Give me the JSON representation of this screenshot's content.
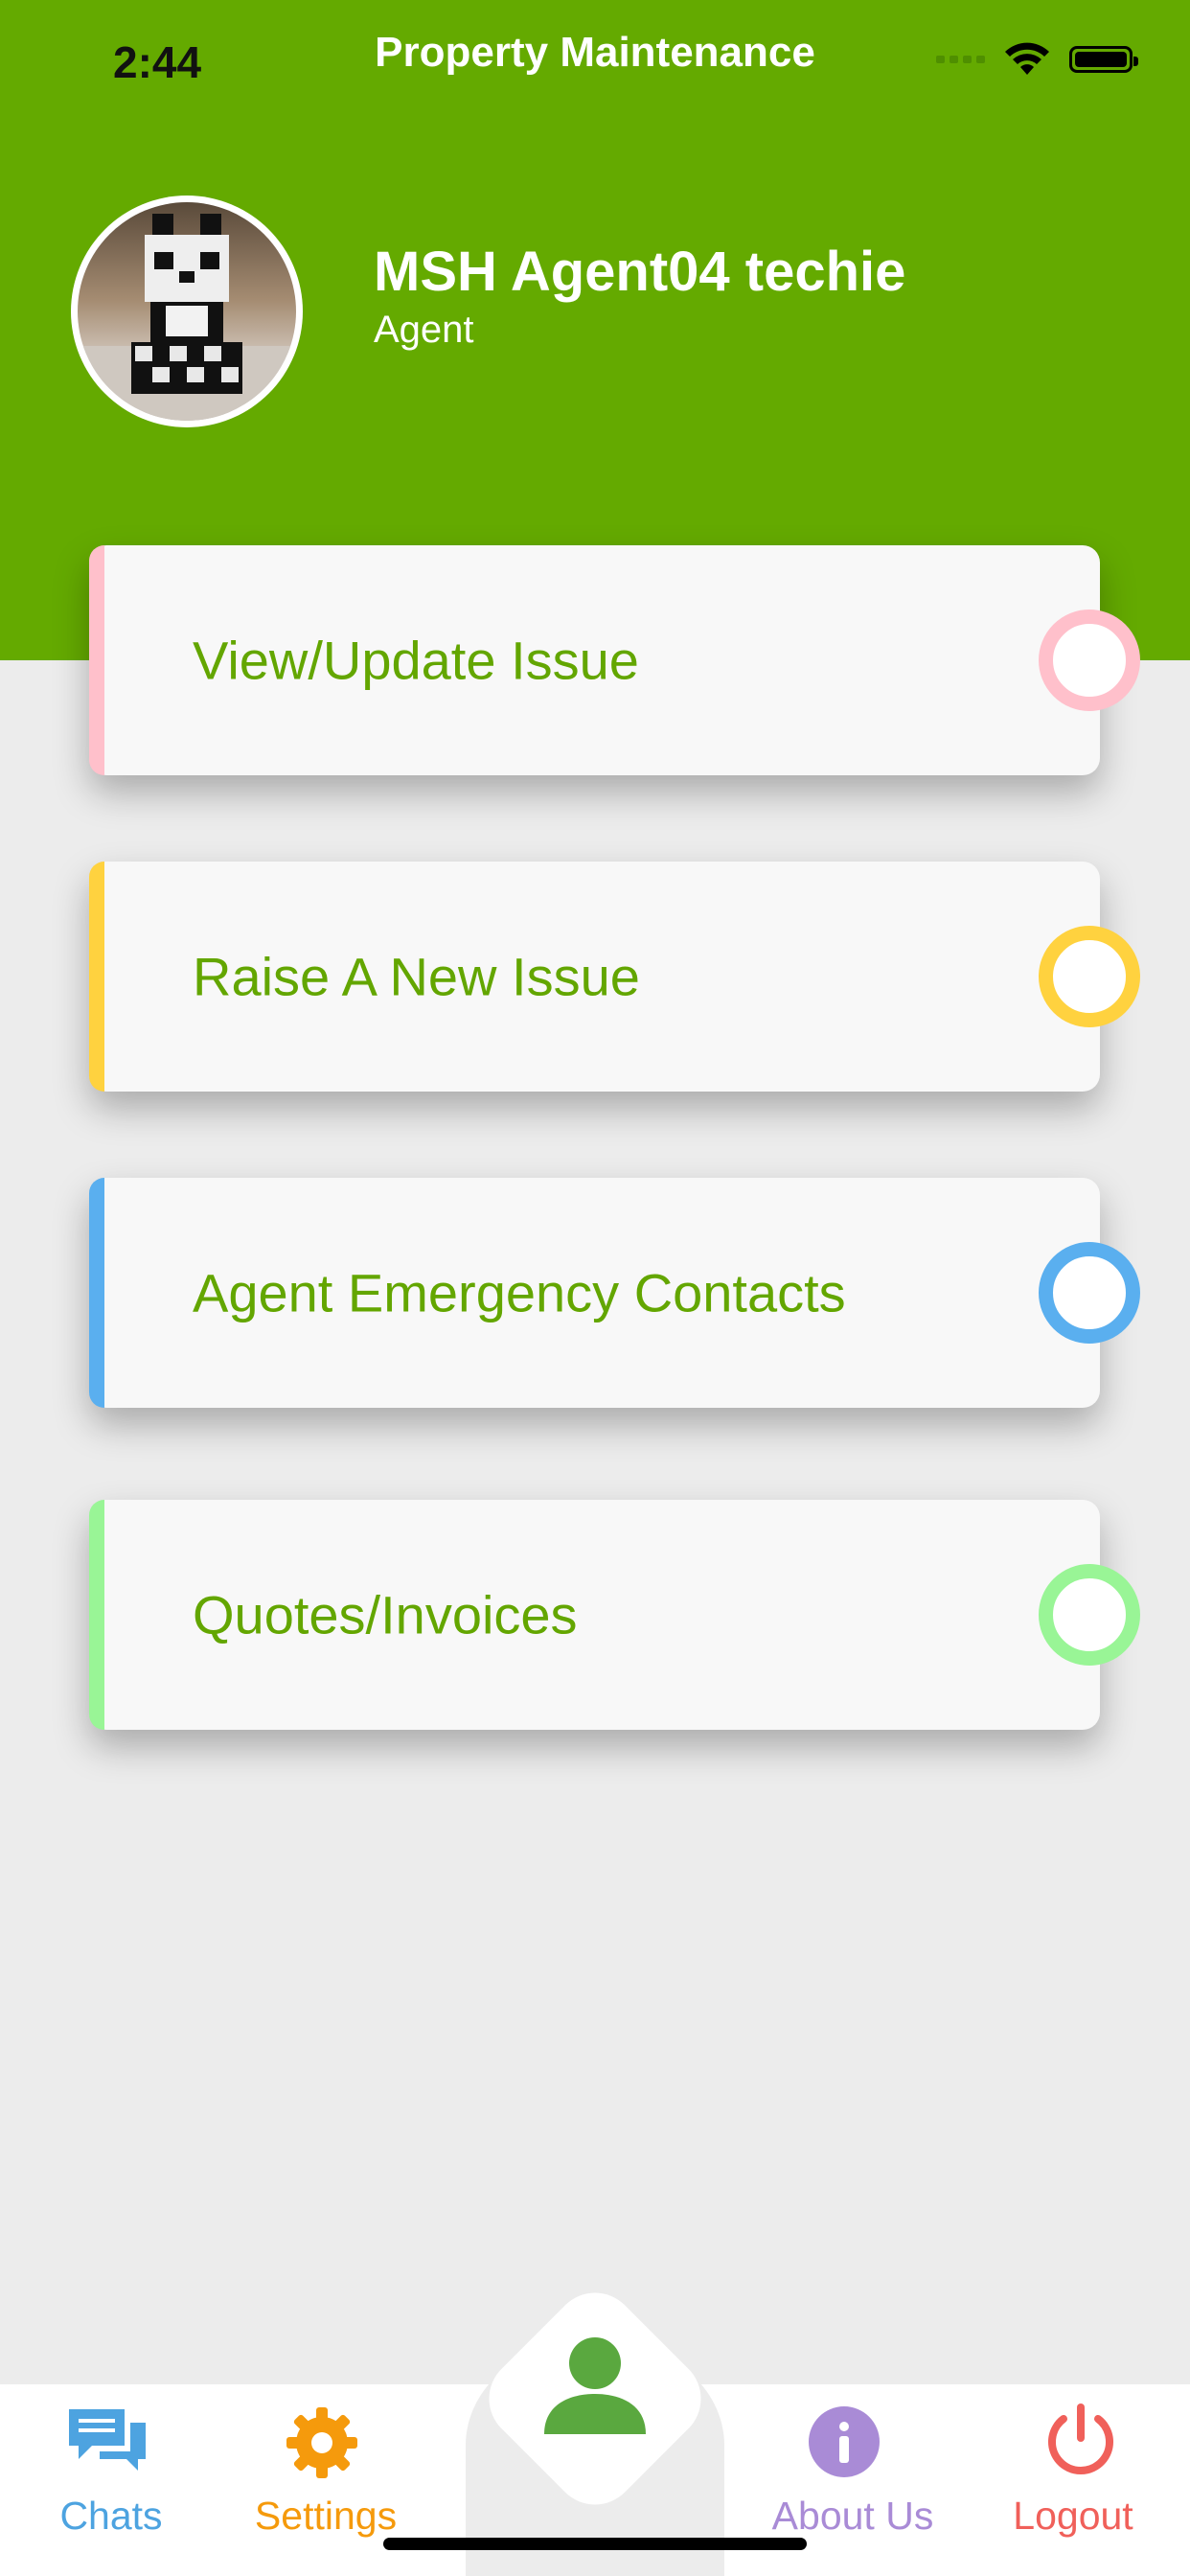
{
  "status_bar": {
    "time": "2:44"
  },
  "header": {
    "title": "Property Maintenance",
    "user_name": "MSH Agent04 techie",
    "user_role": "Agent"
  },
  "menu": [
    {
      "label": "View/Update Issue",
      "color": "#ffc0cb"
    },
    {
      "label": "Raise A New Issue",
      "color": "#ffd23f"
    },
    {
      "label": "Agent Emergency Contacts",
      "color": "#5aafef"
    },
    {
      "label": "Quotes/Invoices",
      "color": "#99f596"
    }
  ],
  "tabbar": {
    "chats": {
      "label": "Chats",
      "icon": "chat-bubbles-icon",
      "color": "#4da3e0"
    },
    "settings": {
      "label": "Settings",
      "icon": "gear-icon",
      "color": "#f59a0c"
    },
    "profile": {
      "icon": "person-icon",
      "color": "#5aa83f"
    },
    "about": {
      "label": "About Us",
      "icon": "info-icon",
      "color": "#a98bd6"
    },
    "logout": {
      "label": "Logout",
      "icon": "power-icon",
      "color": "#f0605a"
    }
  }
}
